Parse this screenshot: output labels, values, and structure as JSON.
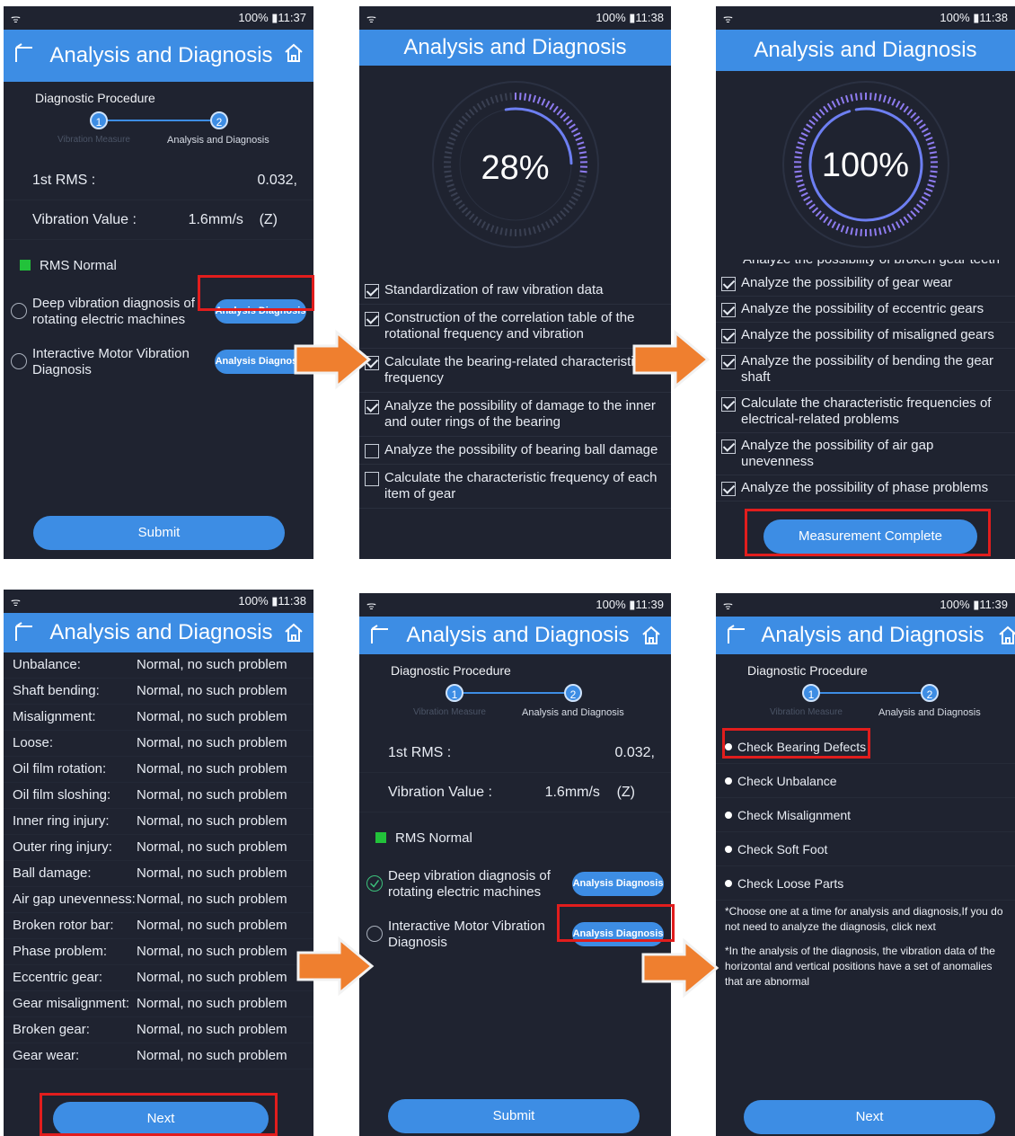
{
  "common": {
    "status_left": "ᯤ",
    "status_right": "100% 11:37",
    "title": "Analysis and Diagnosis",
    "procedure_label": "Diagnostic Procedure",
    "step1_num": "1",
    "step2_num": "2",
    "step1_label": "Vibration Measure",
    "step2_label": "Analysis and Diagnosis"
  },
  "screen1": {
    "time": "100% ▮11:37",
    "rms_label": "1st RMS :",
    "rms_value": "0.032,",
    "vib_label": "Vibration Value :",
    "vib_value": "1.6mm/s",
    "vib_axis": "(Z)",
    "rms_status": "RMS Normal",
    "diag1": "Deep vibration diagnosis of rotating electric machines",
    "diag2": "Interactive Motor Vibration Diagnosis",
    "pill": "Analysis Diagnosis",
    "submit": "Submit"
  },
  "screen2": {
    "time": "100% ▮11:38",
    "progress_text": "28%",
    "progress": 0.28,
    "items": [
      {
        "text": "Standardization of raw vibration data",
        "checked": true
      },
      {
        "text": "Construction of the correlation table of the rotational frequency and vibration",
        "checked": true
      },
      {
        "text": "Calculate the bearing-related characteristic frequency",
        "checked": true
      },
      {
        "text": "Analyze the possibility of damage to the inner and outer rings of the bearing",
        "checked": true
      },
      {
        "text": "Analyze the possibility of bearing ball damage",
        "checked": false
      },
      {
        "text": "Calculate the characteristic frequency of each item of gear",
        "checked": false
      }
    ]
  },
  "screen3": {
    "time": "100% ▮11:38",
    "progress_text": "100%",
    "progress": 1.0,
    "partial": "Analyze the possibility of broken gear teeth",
    "items": [
      "Analyze the possibility of gear wear",
      "Analyze the possibility of eccentric gears",
      "Analyze the possibility of misaligned gears",
      "Analyze the possibility of bending the gear shaft",
      "Calculate the characteristic frequencies of electrical-related problems",
      "Analyze the possibility of air gap unevenness",
      "Analyze the possibility of phase problems"
    ],
    "button": "Measurement Complete"
  },
  "screen4": {
    "time": "100% ▮11:38",
    "result_value": "Normal, no such problem",
    "rows": [
      "Unbalance:",
      "Shaft bending:",
      "Misalignment:",
      "Loose:",
      "Oil film rotation:",
      "Oil film sloshing:",
      "Inner ring injury:",
      "Outer ring injury:",
      "Ball damage:",
      "Air gap unevenness:",
      "Broken rotor bar:",
      "Phase problem:",
      "Eccentric gear:",
      "Gear misalignment:",
      "Broken gear:",
      "Gear wear:"
    ],
    "next": "Next"
  },
  "screen5": {
    "time": "100% ▮11:39",
    "submit": "Submit"
  },
  "screen6": {
    "time": "100% ▮11:39",
    "options": [
      "Check Bearing Defects",
      "Check Unbalance",
      "Check Misalignment",
      "Check Soft Foot",
      "Check Loose Parts"
    ],
    "note1": "*Choose one at a time for analysis and diagnosis,If you do not need to analyze the diagnosis, click next",
    "note2": "*In the analysis of the diagnosis, the vibration data of the horizontal and vertical positions have a set of anomalies that are abnormal",
    "next": "Next"
  },
  "colors": {
    "accent": "#3d8de4",
    "screen_bg": "#1f2330",
    "highlight": "#e11d1d",
    "arrow": "#ef7f2f",
    "ok": "#22c23a"
  }
}
